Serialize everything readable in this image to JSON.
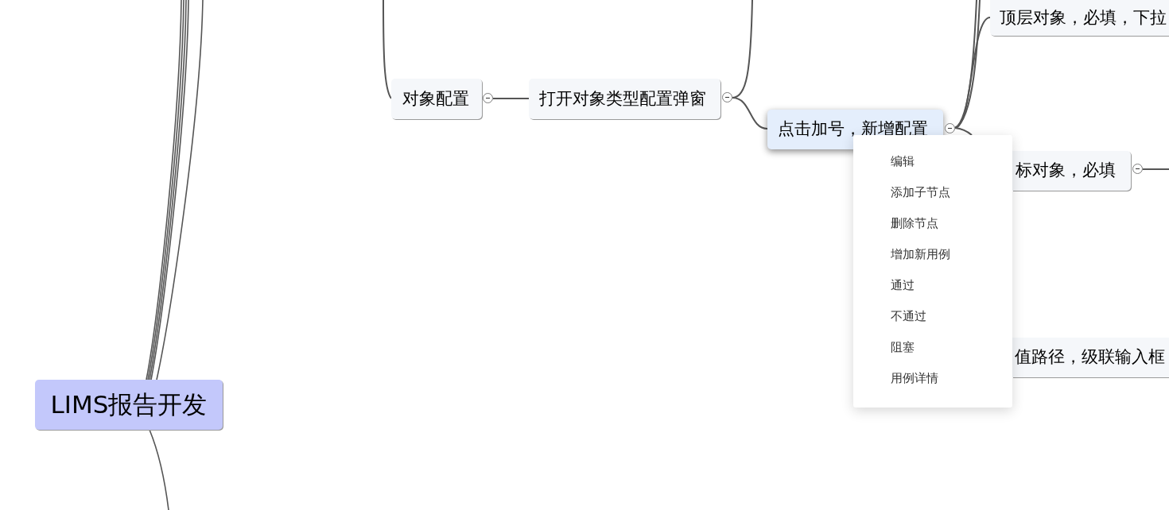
{
  "mind_map": {
    "root": {
      "label": "LIMS报告开发",
      "selected": false
    },
    "branch": {
      "label": "对象配置",
      "selected": false,
      "expanded": true,
      "children": [
        {
          "label": "打开对象类型配置弹窗",
          "selected": false,
          "expanded": true,
          "children": [
            {
              "label": "点击加号，新增配置",
              "selected": true,
              "expanded": true,
              "children": [
                {
                  "label": "顶层对象，必填，下拉",
                  "selected": false
                },
                {
                  "label": "标对象，必填",
                  "selected": false,
                  "expanded": true
                },
                {
                  "label": "值路径，级联输入框",
                  "selected": false
                }
              ]
            }
          ]
        }
      ]
    }
  },
  "context_menu": {
    "items": [
      "编辑",
      "添加子节点",
      "删除节点",
      "增加新用例",
      "通过",
      "不通过",
      "阻塞",
      "用例详情"
    ]
  }
}
